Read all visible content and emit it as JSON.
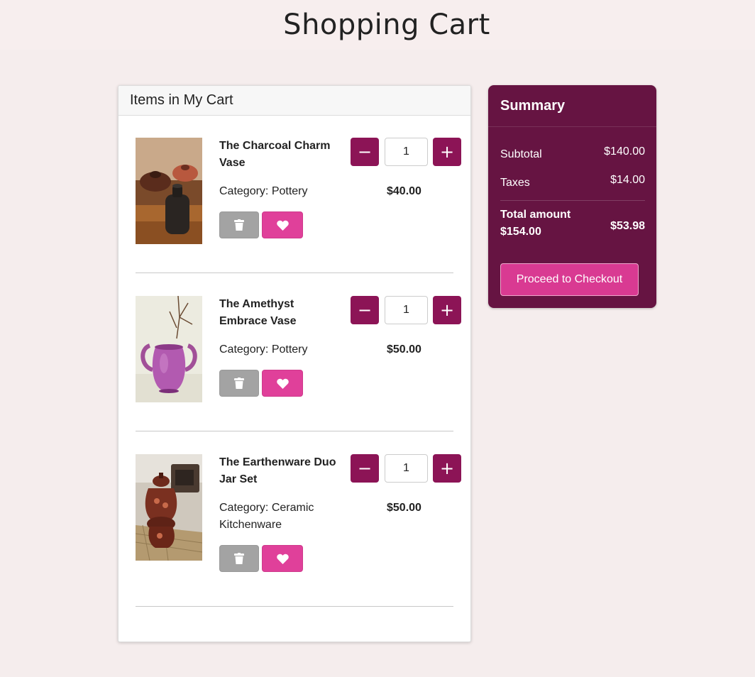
{
  "page": {
    "title": "Shopping Cart"
  },
  "cart": {
    "header": "Items in My Cart",
    "items": [
      {
        "name": "The Charcoal Charm Vase",
        "category": "Category: Pottery",
        "price": "$40.00",
        "quantity": "1",
        "image_icon": "charcoal-vase-photo"
      },
      {
        "name": "The Amethyst Embrace Vase",
        "category": "Category: Pottery",
        "price": "$50.00",
        "quantity": "1",
        "image_icon": "amethyst-vase-photo"
      },
      {
        "name": "The Earthenware Duo Jar Set",
        "category": "Category: Ceramic Kitchenware",
        "price": "$50.00",
        "quantity": "1",
        "image_icon": "earthenware-jar-photo"
      }
    ],
    "controls": {
      "minus": "−",
      "plus": "+"
    }
  },
  "summary": {
    "title": "Summary",
    "subtotal_label": "Subtotal",
    "subtotal_value": "$140.00",
    "taxes_label": "Taxes",
    "taxes_value": "$14.00",
    "total_label": "Total amount $154.00",
    "total_value": "$53.98",
    "checkout_label": "Proceed to Checkout"
  },
  "colors": {
    "accent": "#8c1456",
    "summary_bg": "#661442",
    "wishlist": "#e0409a",
    "delete": "#a3a3a3",
    "page_bg": "#f5eded"
  }
}
